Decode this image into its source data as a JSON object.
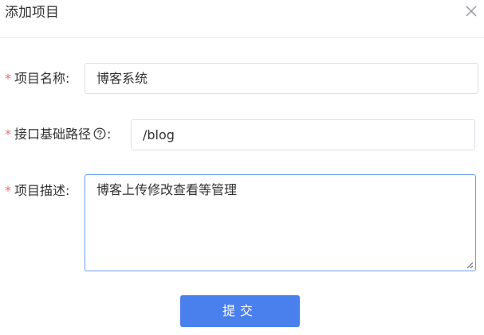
{
  "dialog": {
    "title": "添加项目"
  },
  "form": {
    "name": {
      "required_mark": "*",
      "label": "项目名称:",
      "value": "博客系统"
    },
    "base_path": {
      "required_mark": "*",
      "label": "接口基础路径",
      "label_suffix": ":",
      "value": "/blog"
    },
    "description": {
      "required_mark": "*",
      "label": "项目描述:",
      "value": "博客上传修改查看等管理"
    },
    "submit_label": "提交"
  },
  "icons": {
    "close": "close-icon",
    "help": "question-circle-icon",
    "resize": "resize-handle-icon"
  },
  "colors": {
    "required": "#f56c6c",
    "primary": "#4a7fee",
    "focus_border": "#6b9cf2",
    "border": "#dcdfe6"
  }
}
